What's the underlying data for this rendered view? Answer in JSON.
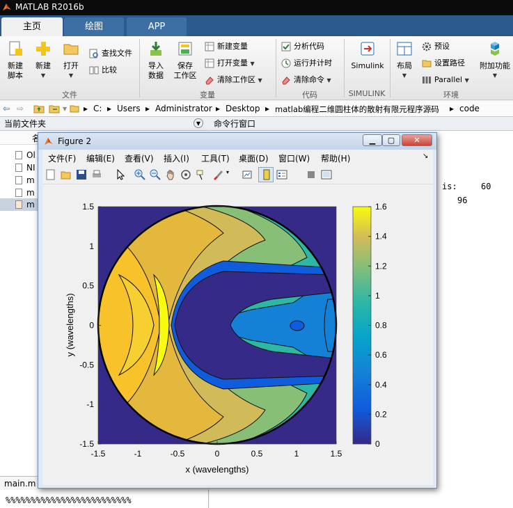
{
  "app": {
    "title": "MATLAB R2016b"
  },
  "tabs": [
    {
      "label": "主页"
    },
    {
      "label": "绘图"
    },
    {
      "label": "APP"
    }
  ],
  "ribbon": {
    "new_script": "新建\n脚本",
    "new_script_1": "新建",
    "new_script_2": "脚本",
    "new": "新建",
    "open": "打开",
    "find_files": "查找文件",
    "compare": "比较",
    "import_1": "导入",
    "import_2": "数据",
    "save_ws_1": "保存",
    "save_ws_2": "工作区",
    "new_var": "新建变量",
    "open_var": "打开变量",
    "clear_ws": "清除工作区",
    "analyze": "分析代码",
    "run_time": "运行并计时",
    "clear_cmd": "清除命令",
    "simulink": "Simulink",
    "layout": "布局",
    "prefs": "预设",
    "set_path": "设置路径",
    "parallel": "Parallel",
    "addons": "附加功能",
    "groups": {
      "file": "文件",
      "variable": "变量",
      "code": "代码",
      "simulink": "SIMULINK",
      "env": "环境"
    }
  },
  "address": {
    "parts": [
      "C:",
      "Users",
      "Administrator",
      "Desktop",
      "matlab编程二维圆柱体的散射有限元程序源码",
      "code"
    ]
  },
  "current_folder": {
    "title": "当前文件夹",
    "col": "名",
    "items": [
      "Ol",
      "NI",
      "m",
      "m",
      "m"
    ]
  },
  "editor_tab": "main.m",
  "editor_line": "%%%%%%%%%%%%%%%%%%%%%%%%%",
  "command_window": {
    "title": "命令行窗口",
    "line1_label": "is:",
    "line1_value": "60",
    "line2_value": "96"
  },
  "figure": {
    "title": "Figure 2",
    "menu": [
      "文件(F)",
      "编辑(E)",
      "查看(V)",
      "插入(I)",
      "工具(T)",
      "桌面(D)",
      "窗口(W)",
      "帮助(H)"
    ]
  },
  "chart_data": {
    "type": "heatmap",
    "title": "",
    "xlabel": "x (wavelengths)",
    "ylabel": "y (wavelengths)",
    "xlim": [
      -1.5,
      1.5
    ],
    "ylim": [
      -1.5,
      1.5
    ],
    "xticks": [
      "-1.5",
      "-1",
      "-0.5",
      "0",
      "0.5",
      "1",
      "1.5"
    ],
    "yticks": [
      "1.5",
      "1",
      "0.5",
      "0",
      "-0.5",
      "-1",
      "-1.5"
    ],
    "colorbar_ticks": [
      "1.6",
      "1.4",
      "1.2",
      "1",
      "0.8",
      "0.6",
      "0.4",
      "0.2",
      "0"
    ],
    "colorbar_range": [
      0,
      1.6
    ],
    "colormap": "parula",
    "domain": "circle of radius 1.5 centered at origin",
    "shadow_region_center": [
      0.55,
      0
    ],
    "max_band_x": -0.65
  }
}
